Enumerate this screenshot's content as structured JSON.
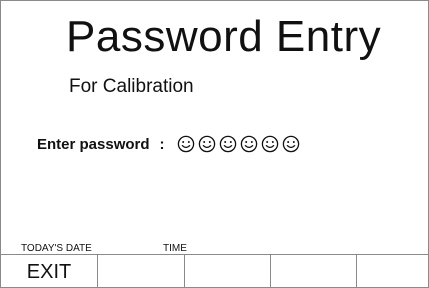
{
  "screen": {
    "title": "Password Entry",
    "subtitle": "For Calibration"
  },
  "password": {
    "label": "Enter password",
    "colon": ":",
    "mask_icon": "smiley-icon",
    "mask_count": 6
  },
  "footer": {
    "date_label": "TODAY'S DATE",
    "time_label": "TIME"
  },
  "softkeys": [
    {
      "label": "EXIT"
    },
    {
      "label": ""
    },
    {
      "label": ""
    },
    {
      "label": ""
    },
    {
      "label": ""
    }
  ]
}
